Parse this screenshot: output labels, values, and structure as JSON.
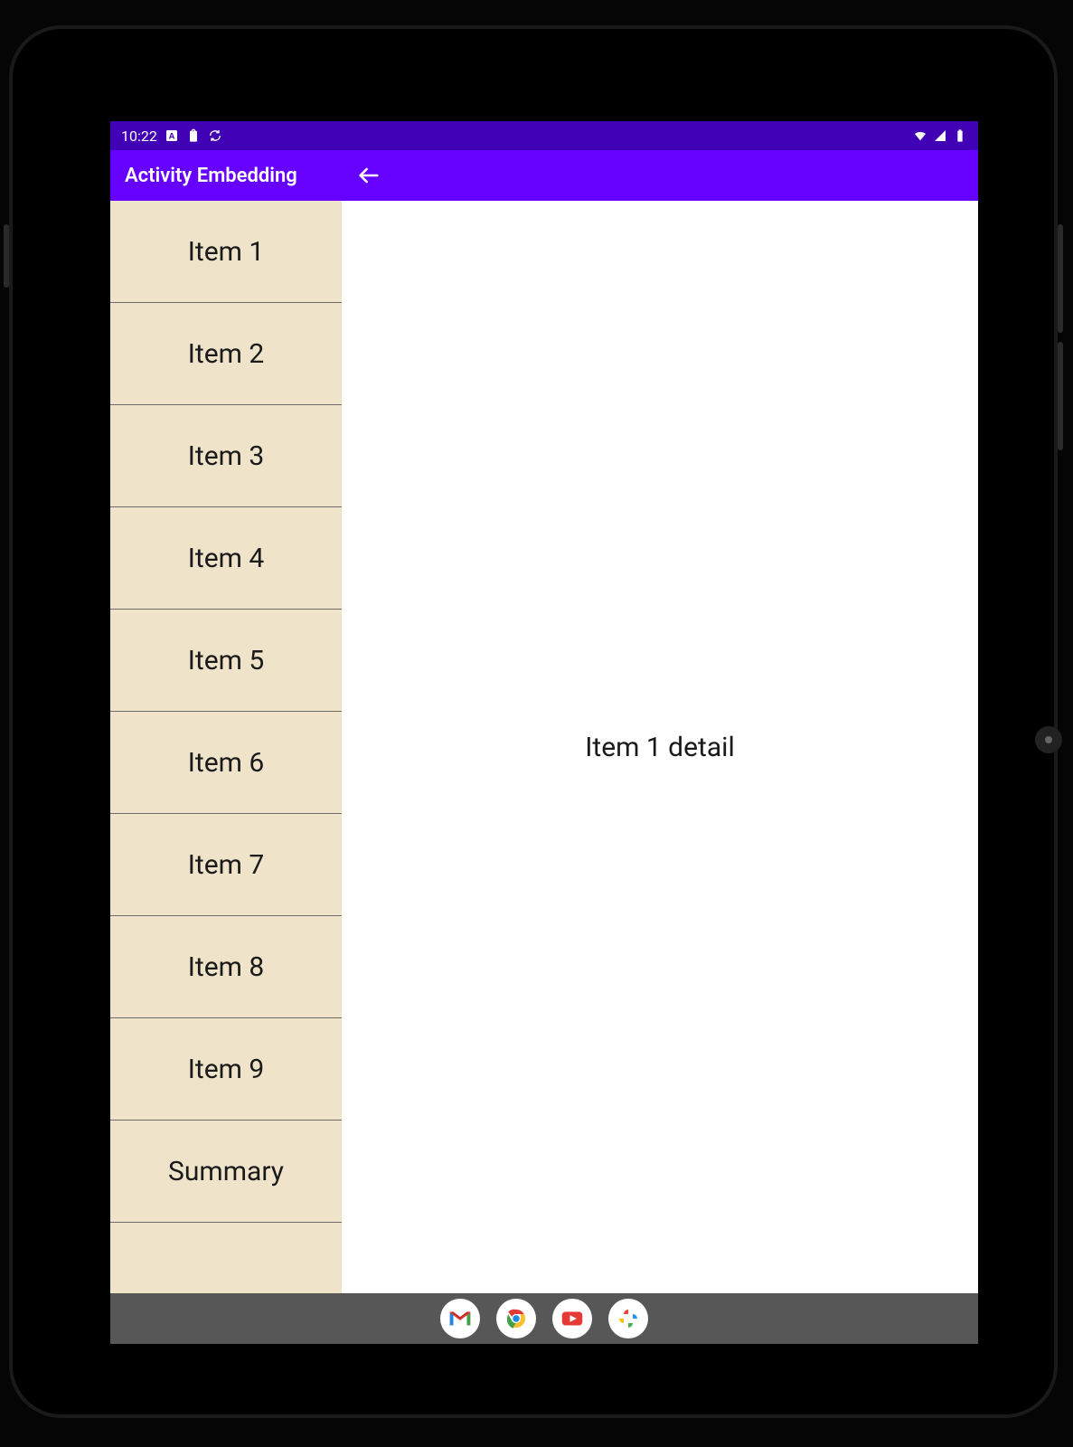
{
  "status": {
    "time": "10:22",
    "icons_left": [
      "a-badge-icon",
      "clipboard-icon",
      "sync-icon"
    ],
    "icons_right": [
      "wifi-icon",
      "signal-icon",
      "battery-icon"
    ]
  },
  "appbar": {
    "title": "Activity Embedding",
    "back_icon": "arrow-back-icon"
  },
  "list": {
    "items": [
      {
        "label": "Item 1"
      },
      {
        "label": "Item 2"
      },
      {
        "label": "Item 3"
      },
      {
        "label": "Item 4"
      },
      {
        "label": "Item 5"
      },
      {
        "label": "Item 6"
      },
      {
        "label": "Item 7"
      },
      {
        "label": "Item 8"
      },
      {
        "label": "Item 9"
      },
      {
        "label": "Summary"
      }
    ]
  },
  "detail": {
    "text": "Item 1 detail"
  },
  "nav": {
    "apps": [
      "gmail-icon",
      "chrome-icon",
      "youtube-icon",
      "photos-icon"
    ]
  }
}
